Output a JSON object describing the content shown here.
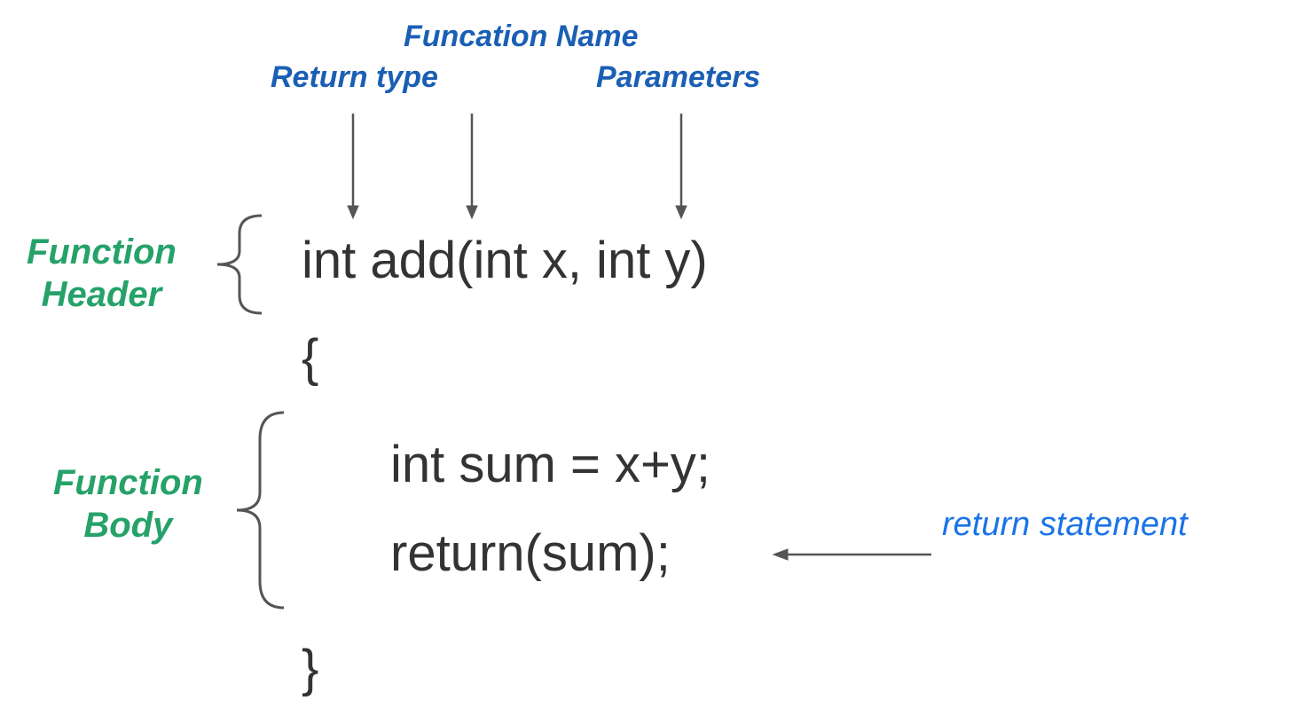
{
  "labels": {
    "function_name": "Funcation Name",
    "return_type": "Return type",
    "parameters": "Parameters",
    "function_header_line1": "Function",
    "function_header_line2": "Header",
    "function_body_line1": "Function",
    "function_body_line2": "Body",
    "return_statement": "return statement"
  },
  "code": {
    "signature": "int add(int x, int y)",
    "open_brace": "{",
    "line1": "int sum = x+y;",
    "line2": "return(sum);",
    "close_brace": "}"
  }
}
